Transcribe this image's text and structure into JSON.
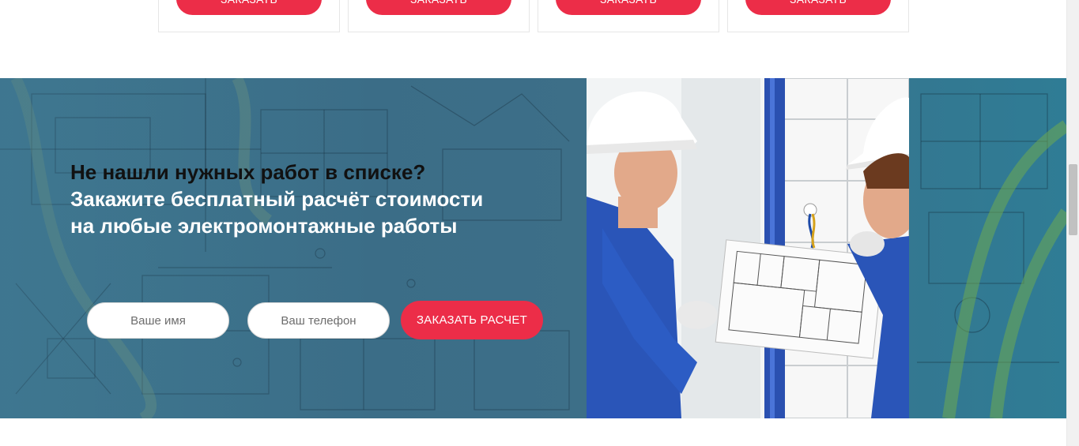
{
  "cards": [
    {
      "button_label": "Заказать"
    },
    {
      "button_label": "Заказать"
    },
    {
      "button_label": "Заказать"
    },
    {
      "button_label": "Заказать"
    }
  ],
  "banner": {
    "headline_line1": "Не нашли нужных работ в списке?",
    "headline_line2": "Закажите бесплатный расчёт стоимости",
    "headline_line3": "на любые электромонтажные работы",
    "name_placeholder": "Ваше имя",
    "phone_placeholder": "Ваш телефон",
    "submit_label": "Заказать расчет"
  },
  "colors": {
    "accent": "#ec2d48",
    "banner_bg": "#3d6f88",
    "headline_dark": "#111111",
    "headline_light": "#ffffff"
  },
  "icons": {
    "photo": "electricians-photo",
    "background": "blueprint-background"
  }
}
